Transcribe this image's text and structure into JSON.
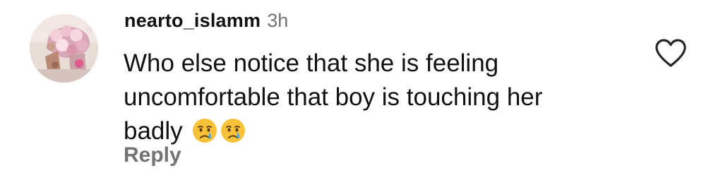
{
  "comment": {
    "username": "nearto_islamm",
    "timestamp": "3h",
    "text_lines": [
      "Who else notice that she is feeling",
      "uncomfortable that boy is touching her",
      "badly"
    ],
    "emojis": [
      "crying-face",
      "crying-face"
    ],
    "reply_label": "Reply",
    "like_icon": "heart-outline-icon"
  },
  "colors": {
    "username": "#111111",
    "secondary_text": "#737373",
    "icon": "#262626",
    "emoji_face": "#f7c23a",
    "emoji_tear": "#4aa3df"
  }
}
